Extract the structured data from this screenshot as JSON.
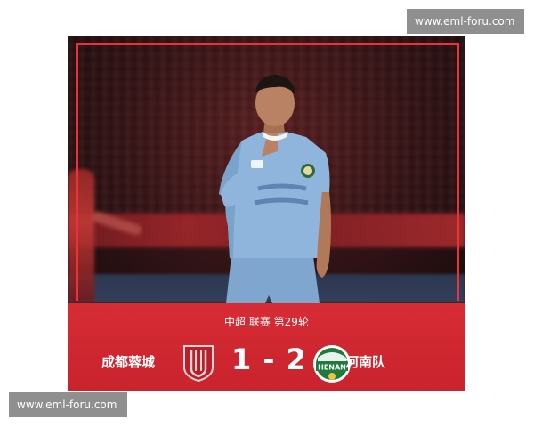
{
  "watermark": {
    "top_text": "www.eml-foru.com",
    "bottom_text": "www.eml-foru.com"
  },
  "match": {
    "league_line": "中超  联赛  第29轮",
    "home_team": "成都蓉城",
    "away_team": "河南队",
    "home_score": "1",
    "separator": "-",
    "away_score": "2",
    "away_badge_text": "HENAN"
  },
  "colors": {
    "band_red": "#d62c35",
    "frame_red": "#e8333b",
    "jersey_blue": "#8fb5dc",
    "watermark_gray": "#8f8f8f"
  }
}
